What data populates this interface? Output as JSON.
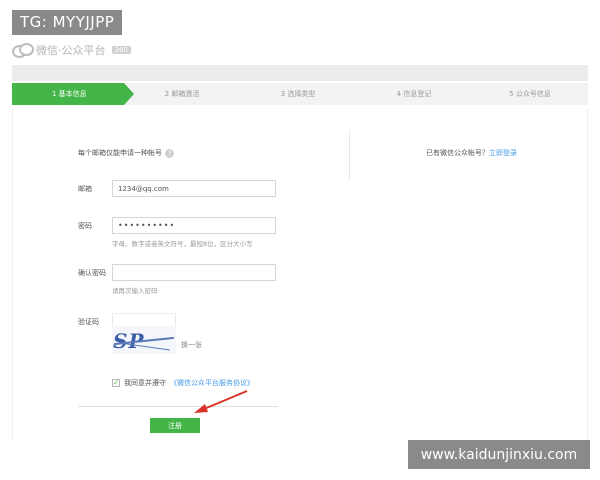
{
  "overlay": {
    "tg_tag": "TG: MYYJJPP",
    "watermark": "www.kaidunjinxiu.com"
  },
  "brand": {
    "name": "微信·公众平台",
    "chip": "360",
    "icon": "wechat-logo-icon"
  },
  "steps": [
    {
      "label": "1 基本信息",
      "active": true
    },
    {
      "label": "2 邮箱激活",
      "active": false
    },
    {
      "label": "3 选择类型",
      "active": false
    },
    {
      "label": "4 信息登记",
      "active": false
    },
    {
      "label": "5 公众号信息",
      "active": false
    }
  ],
  "form": {
    "heading": "每个邮箱仅能申请一种帐号",
    "help_icon": "question-icon",
    "right_note_prefix": "已有微信公众帐号？",
    "right_note_link": "立即登录",
    "email_label": "邮箱",
    "email_value": "1234@qq.com",
    "password_label": "密码",
    "password_value": "••••••••••",
    "password_hint": "字母、数字或者英文符号，最短8位，区分大小写",
    "confirm_label": "确认密码",
    "confirm_hint": "请再次输入密码",
    "captcha_label": "验证码",
    "captcha_text": "SP FKx",
    "captcha_refresh": "换一张",
    "agree_prefix": "我同意并遵守",
    "agree_link": "《微信公众平台服务协议》",
    "agree_checked": "✓",
    "register_label": "注册"
  },
  "colors": {
    "accent_green": "#44b549",
    "link_blue": "#459ae9",
    "arrow_red": "#d9342b"
  }
}
